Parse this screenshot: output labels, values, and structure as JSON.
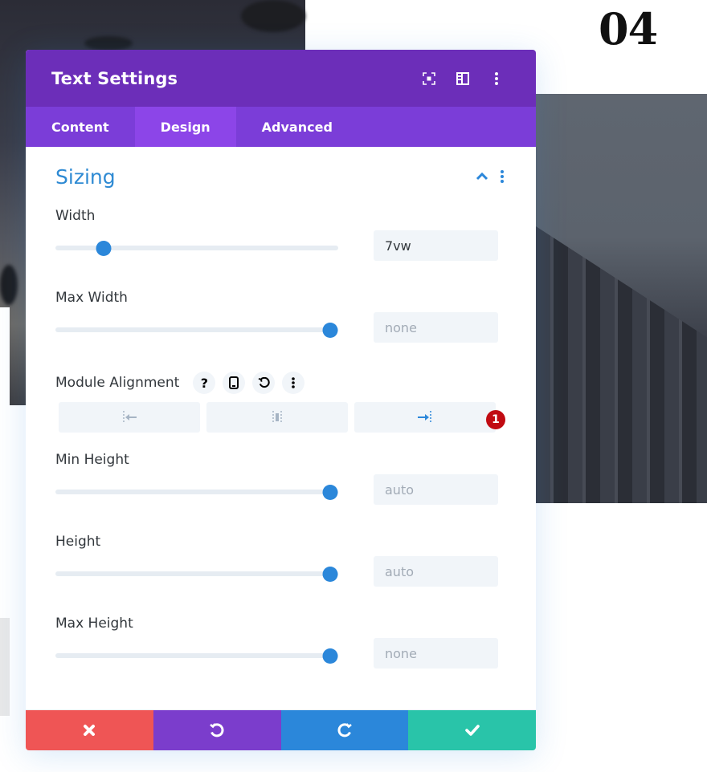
{
  "background": {
    "section_number": "04"
  },
  "modal": {
    "title": "Text Settings",
    "header_icons": [
      "fullscreen-icon",
      "split-view-icon",
      "more-options-icon"
    ],
    "tabs": [
      {
        "label": "Content",
        "active": false
      },
      {
        "label": "Design",
        "active": true
      },
      {
        "label": "Advanced",
        "active": false
      }
    ],
    "section": {
      "title": "Sizing",
      "expanded": true
    },
    "fields": {
      "width": {
        "label": "Width",
        "value": "7vw",
        "slider_fraction": 0.09
      },
      "max_width": {
        "label": "Max Width",
        "value": "none",
        "slider_fraction": 1.0
      },
      "module_alignment": {
        "label": "Module Alignment",
        "options": [
          "left",
          "center",
          "right"
        ],
        "selected": "right",
        "badge": "1"
      },
      "min_height": {
        "label": "Min Height",
        "value": "auto",
        "slider_fraction": 1.0
      },
      "height": {
        "label": "Height",
        "value": "auto",
        "slider_fraction": 1.0
      },
      "max_height": {
        "label": "Max Height",
        "value": "none",
        "slider_fraction": 1.0
      }
    },
    "footer": {
      "buttons": [
        "cancel",
        "undo",
        "redo",
        "save"
      ]
    }
  },
  "colors": {
    "header": "#6c2eb9",
    "tabs": "#7b3dd8",
    "active_tab": "#8c45e8",
    "accent_blue": "#2b87da",
    "cancel": "#ef5555",
    "undo": "#7b3dcc",
    "redo": "#2b87da",
    "save": "#29c4a9",
    "badge": "#c10b12"
  }
}
